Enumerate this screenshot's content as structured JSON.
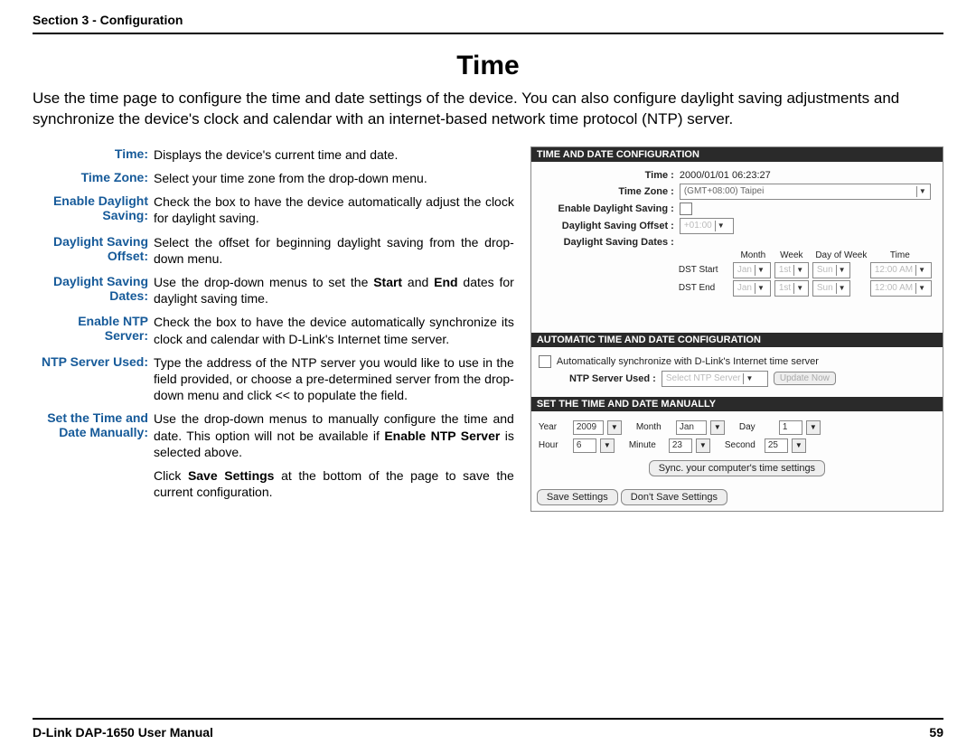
{
  "header": {
    "section": "Section 3 - Configuration"
  },
  "title": "Time",
  "intro": "Use the time page to configure the time and date settings of the device. You can also configure daylight saving adjustments and synchronize the device's clock and calendar with an internet-based network time protocol (NTP) server.",
  "defs": {
    "time": {
      "label": "Time:",
      "text": "Displays the device's current time and date."
    },
    "tz": {
      "label": "Time Zone:",
      "text": "Select your time zone from the drop-down menu."
    },
    "eds": {
      "label": "Enable Daylight Saving:",
      "text": "Check the box to have the device automatically adjust the clock for daylight saving."
    },
    "dso": {
      "label": "Daylight Saving Offset:",
      "text": "Select the offset for beginning daylight saving from the drop-down menu."
    },
    "dsd": {
      "label": "Daylight Saving Dates:",
      "text_a": "Use the drop-down menus to set the ",
      "b1": "Start",
      "mid": " and ",
      "b2": "End",
      "text_b": " dates for daylight saving time."
    },
    "ens": {
      "label": "Enable NTP Server:",
      "text": "Check the box to have the device automatically synchronize its clock and calendar with D-Link's Internet time server."
    },
    "nsu": {
      "label": "NTP Server Used:",
      "text": "Type the address of the NTP server you would like to use in the field provided, or choose a pre-determined server from the drop-down menu and click << to populate the field."
    },
    "man": {
      "label": "Set the Time and Date Manually:",
      "text_a": "Use the drop-down menus to manually configure the time and date. This option will not be available if ",
      "b1": "Enable NTP Server",
      "text_b": " is selected above."
    },
    "save": {
      "text_a": "Click ",
      "b1": "Save Settings",
      "text_b": " at the bottom of the page to save the current configuration."
    }
  },
  "config": {
    "hdr1": "TIME AND DATE CONFIGURATION",
    "time_label": "Time  :",
    "time_value": "2000/01/01 06:23:27",
    "tz_label": "Time Zone  :",
    "tz_value": "(GMT+08:00) Taipei",
    "eds_label": "Enable Daylight Saving  :",
    "dso_label": "Daylight Saving Offset  :",
    "dso_value": "+01:00",
    "dsd_label": "Daylight Saving Dates  :",
    "dst_hdr": {
      "month": "Month",
      "week": "Week",
      "dow": "Day of Week",
      "time": "Time"
    },
    "dst_start": {
      "label": "DST Start",
      "month": "Jan",
      "week": "1st",
      "dow": "Sun",
      "time": "12:00 AM"
    },
    "dst_end": {
      "label": "DST End",
      "month": "Jan",
      "week": "1st",
      "dow": "Sun",
      "time": "12:00 AM"
    },
    "hdr2": "AUTOMATIC TIME AND DATE CONFIGURATION",
    "auto_sync": "Automatically synchronize with D-Link's Internet time server",
    "ntp_label": "NTP Server Used  :",
    "ntp_value": "Select NTP Server",
    "update_now": "Update Now",
    "hdr3": "SET THE TIME AND DATE MANUALLY",
    "year_l": "Year",
    "year_v": "2009",
    "month_l": "Month",
    "month_v": "Jan",
    "day_l": "Day",
    "day_v": "1",
    "hour_l": "Hour",
    "hour_v": "6",
    "minute_l": "Minute",
    "minute_v": "23",
    "second_l": "Second",
    "second_v": "25",
    "sync_btn": "Sync. your computer's time settings",
    "save_btn": "Save Settings",
    "dont_save_btn": "Don't Save Settings"
  },
  "footer": {
    "left": "D-Link DAP-1650 User Manual",
    "right": "59"
  }
}
